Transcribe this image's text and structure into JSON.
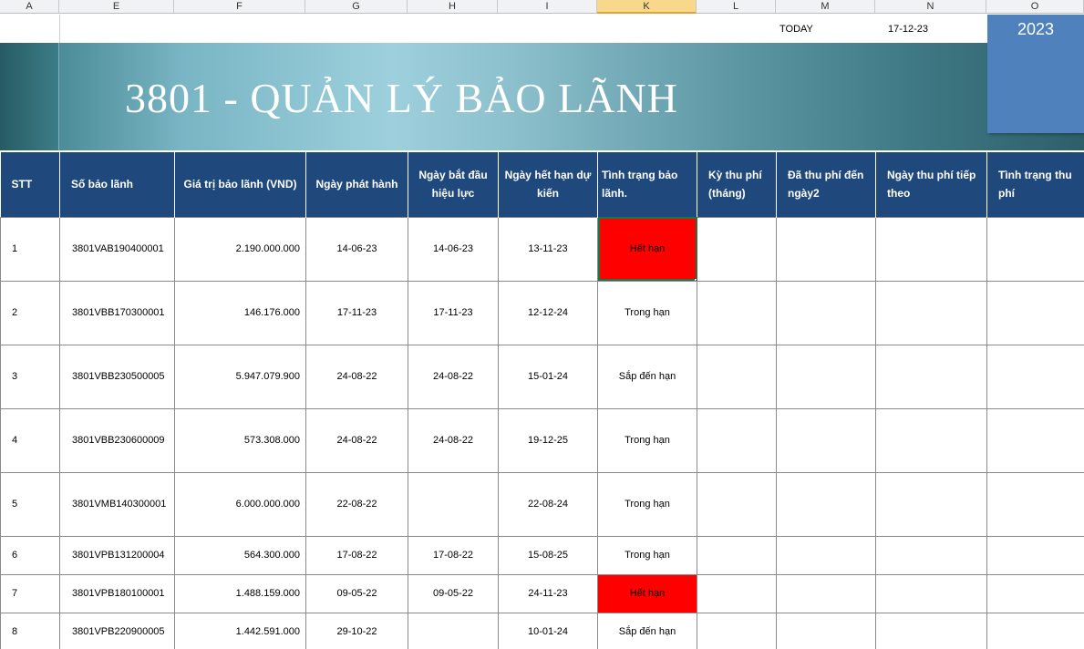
{
  "columns": [
    "A",
    "E",
    "F",
    "G",
    "H",
    "I",
    "K",
    "L",
    "M",
    "N",
    "O"
  ],
  "selected_column": "K",
  "today_label": "TODAY",
  "today_value": "17-12-23",
  "year": "2023",
  "title": "3801 - QUẢN LÝ BẢO LÃNH",
  "colors": {
    "header_bg": "#1f497d",
    "year_box": "#4f81bd",
    "expired": "#ff0000",
    "banner": "#79b5c4"
  },
  "table": {
    "headers": [
      "STT",
      "Số bảo lãnh",
      "Giá trị bảo lãnh (VND)",
      "Ngày phát hành",
      "Ngày bắt đầu hiệu lực",
      "Ngày hết hạn dự kiến",
      "Tình trạng bảo lãnh.",
      "Kỳ thu phí (tháng)",
      "Đã thu phí đến ngày2",
      "Ngày thu phí tiếp theo",
      "Tình trạng thu phí"
    ],
    "rows": [
      {
        "stt": "1",
        "so": "3801VAB190400001",
        "gia_tri": "2.190.000.000",
        "ngay_phat_hanh": "14-06-23",
        "ngay_bat_dau": "14-06-23",
        "ngay_het_han": "13-11-23",
        "tinh_trang": "Hết hạn"
      },
      {
        "stt": "2",
        "so": "3801VBB170300001",
        "gia_tri": "146.176.000",
        "ngay_phat_hanh": "17-11-23",
        "ngay_bat_dau": "17-11-23",
        "ngay_het_han": "12-12-24",
        "tinh_trang": "Trong hạn"
      },
      {
        "stt": "3",
        "so": "3801VBB230500005",
        "gia_tri": "5.947.079.900",
        "ngay_phat_hanh": "24-08-22",
        "ngay_bat_dau": "24-08-22",
        "ngay_het_han": "15-01-24",
        "tinh_trang": "Sắp đến hạn"
      },
      {
        "stt": "4",
        "so": "3801VBB230600009",
        "gia_tri": "573.308.000",
        "ngay_phat_hanh": "24-08-22",
        "ngay_bat_dau": "24-08-22",
        "ngay_het_han": "19-12-25",
        "tinh_trang": "Trong hạn"
      },
      {
        "stt": "5",
        "so": "3801VMB140300001",
        "gia_tri": "6.000.000.000",
        "ngay_phat_hanh": "22-08-22",
        "ngay_bat_dau": "",
        "ngay_het_han": "22-08-24",
        "tinh_trang": "Trong hạn"
      },
      {
        "stt": "6",
        "so": "3801VPB131200004",
        "gia_tri": "564.300.000",
        "ngay_phat_hanh": "17-08-22",
        "ngay_bat_dau": "17-08-22",
        "ngay_het_han": "15-08-25",
        "tinh_trang": "Trong hạn"
      },
      {
        "stt": "7",
        "so": "3801VPB180100001",
        "gia_tri": "1.488.159.000",
        "ngay_phat_hanh": "09-05-22",
        "ngay_bat_dau": "09-05-22",
        "ngay_het_han": "24-11-23",
        "tinh_trang": "Hết hạn"
      },
      {
        "stt": "8",
        "so": "3801VPB220900005",
        "gia_tri": "1.442.591.000",
        "ngay_phat_hanh": "29-10-22",
        "ngay_bat_dau": "",
        "ngay_het_han": "10-01-24",
        "tinh_trang": "Sắp đến hạn"
      }
    ]
  }
}
